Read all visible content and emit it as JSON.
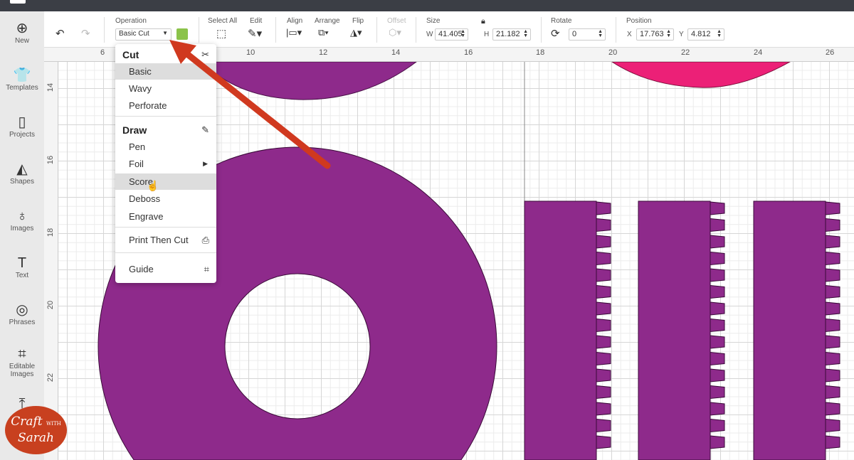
{
  "sidebar": {
    "items": [
      {
        "label": "New",
        "icon": "plus-circle-icon"
      },
      {
        "label": "Templates",
        "icon": "shirt-icon"
      },
      {
        "label": "Projects",
        "icon": "projects-icon"
      },
      {
        "label": "Shapes",
        "icon": "shapes-icon"
      },
      {
        "label": "Images",
        "icon": "bulb-icon"
      },
      {
        "label": "Text",
        "icon": "text-icon"
      },
      {
        "label": "Phrases",
        "icon": "speech-icon"
      },
      {
        "label": "Editable Images",
        "icon": "editable-images-icon"
      }
    ]
  },
  "toolbar": {
    "operation_label": "Operation",
    "operation_value": "Basic Cut",
    "operation_color": "#8bc34a",
    "select_all": "Select All",
    "edit": "Edit",
    "align": "Align",
    "arrange": "Arrange",
    "flip": "Flip",
    "offset": "Offset",
    "size": "Size",
    "w_label": "W",
    "w_value": "41.405",
    "h_label": "H",
    "h_value": "21.182",
    "rotate": "Rotate",
    "rotate_value": "0",
    "position": "Position",
    "x_label": "X",
    "x_value": "17.763",
    "y_label": "Y",
    "y_value": "4.812"
  },
  "ruler": {
    "top": [
      "6",
      "10",
      "12",
      "14",
      "16",
      "18",
      "20",
      "22",
      "24",
      "26"
    ],
    "left": [
      "14",
      "16",
      "18",
      "20",
      "22"
    ]
  },
  "menu": {
    "cut": "Cut",
    "cut_items": [
      "Basic",
      "Wavy",
      "Perforate"
    ],
    "draw": "Draw",
    "draw_items": [
      "Pen",
      "Foil",
      "Score",
      "Deboss",
      "Engrave"
    ],
    "print_then_cut": "Print Then Cut",
    "guide": "Guide",
    "selected": "Basic",
    "hovered": "Score"
  },
  "logo": {
    "line1": "Craft",
    "with": "WITH",
    "line2": "Sarah"
  },
  "colors": {
    "purple": "#8e2a8b",
    "pink": "#ec2077",
    "arrow": "#d0391f"
  }
}
